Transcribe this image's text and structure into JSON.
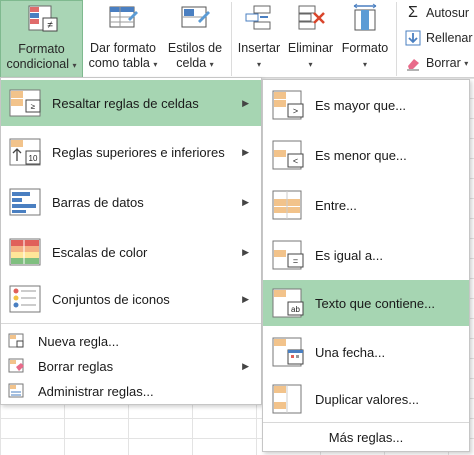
{
  "ribbon": {
    "formato_condicional": {
      "line1": "Formato",
      "line2": "condicional"
    },
    "dar_formato": {
      "line1": "Dar formato",
      "line2": "como tabla"
    },
    "estilos": {
      "line1": "Estilos de",
      "line2": "celda"
    },
    "insertar": {
      "line1": "Insertar"
    },
    "eliminar": {
      "line1": "Eliminar"
    },
    "formato": {
      "line1": "Formato"
    },
    "autosuma": "Autosur",
    "rellenar": "Rellenar",
    "borrar": "Borrar",
    "caret": "▾",
    "sigma": "Σ"
  },
  "menu_main": {
    "items": [
      {
        "label": "Resaltar reglas de celdas",
        "icon": "highlight-cells-icon",
        "submenu": true
      },
      {
        "label": "Reglas superiores e inferiores",
        "icon": "top-bottom-icon",
        "submenu": true
      },
      {
        "label": "Barras de datos",
        "icon": "data-bars-icon",
        "submenu": true
      },
      {
        "label": "Escalas de color",
        "icon": "color-scales-icon",
        "submenu": true
      },
      {
        "label": "Conjuntos de iconos",
        "icon": "icon-sets-icon",
        "submenu": true
      }
    ],
    "small_items": [
      {
        "label": "Nueva regla...",
        "icon": "new-rule-icon",
        "submenu": false
      },
      {
        "label": "Borrar reglas",
        "icon": "clear-rules-icon",
        "submenu": true
      },
      {
        "label": "Administrar reglas...",
        "icon": "manage-rules-icon",
        "submenu": false
      }
    ],
    "arrow": "▶"
  },
  "menu_sub": {
    "items": [
      {
        "label": "Es mayor que...",
        "icon": "greater-than-icon",
        "symbol": ">"
      },
      {
        "label": "Es menor que...",
        "icon": "less-than-icon",
        "symbol": "<"
      },
      {
        "label": "Entre...",
        "icon": "between-icon",
        "symbol": ""
      },
      {
        "label": "Es igual a...",
        "icon": "equal-to-icon",
        "symbol": "="
      },
      {
        "label": "Texto que contiene...",
        "icon": "text-contains-icon",
        "symbol": "ab"
      },
      {
        "label": "Una fecha...",
        "icon": "date-icon",
        "symbol": ""
      },
      {
        "label": "Duplicar valores...",
        "icon": "duplicate-values-icon",
        "symbol": ""
      }
    ],
    "more": "Más reglas..."
  },
  "colors": {
    "highlight": "#a6d5b2",
    "ribbon_active": "#a9d5b5",
    "accent_orange": "#f2c38b",
    "accent_blue": "#4a7fc1"
  }
}
